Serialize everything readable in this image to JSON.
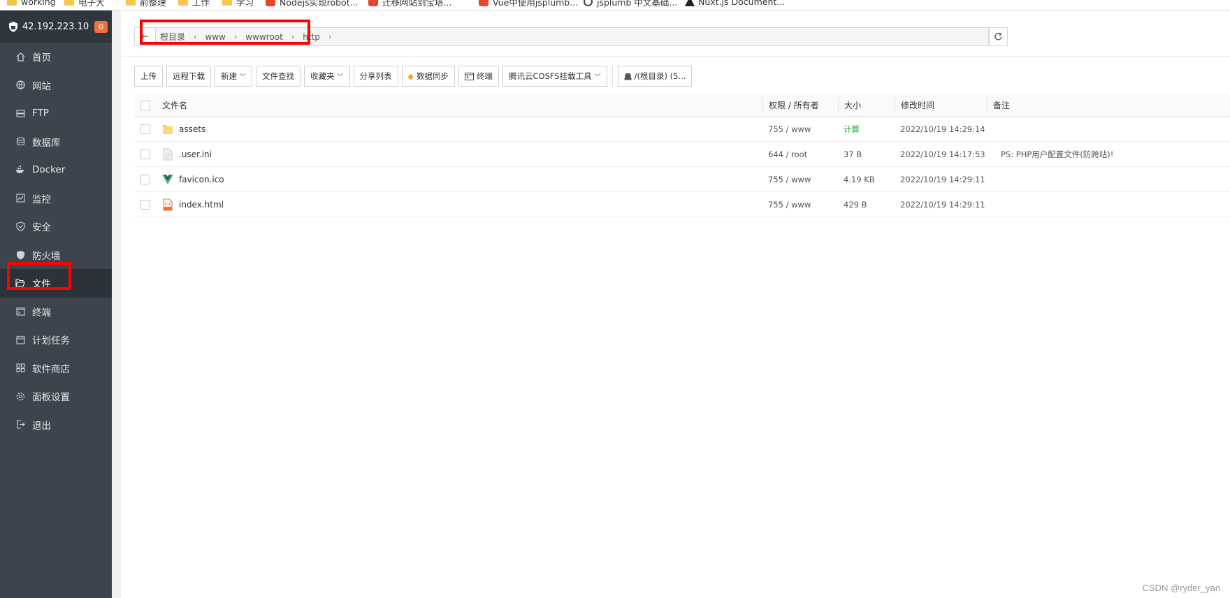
{
  "bookmarks": [
    {
      "label": "working",
      "icon": "folder-icon"
    },
    {
      "label": "电子大",
      "icon": "folder-icon"
    },
    {
      "label": "前整理",
      "icon": "folder-icon"
    },
    {
      "label": "工作",
      "icon": "folder-icon"
    },
    {
      "label": "学习",
      "icon": "folder-icon"
    },
    {
      "label": "Nodejs实现robot...",
      "icon": "csdn-icon"
    },
    {
      "label": "迁移网站到宝塔...",
      "icon": "csdn-icon"
    },
    {
      "label": "Vue中使用jsplumb...",
      "icon": "csdn-icon"
    },
    {
      "label": "jsplumb 中文基础...",
      "icon": "github-icon"
    },
    {
      "label": "Nuxt.js Document...",
      "icon": "nuxt-icon"
    }
  ],
  "sidebar": {
    "host": "42.192.223.10",
    "badge": "0",
    "items": [
      {
        "label": "首页",
        "icon": "home-icon"
      },
      {
        "label": "网站",
        "icon": "globe-icon"
      },
      {
        "label": "FTP",
        "icon": "ftp-icon"
      },
      {
        "label": "数据库",
        "icon": "database-icon"
      },
      {
        "label": "Docker",
        "icon": "docker-icon"
      },
      {
        "label": "监控",
        "icon": "monitor-icon"
      },
      {
        "label": "安全",
        "icon": "shield-check-icon"
      },
      {
        "label": "防火墙",
        "icon": "firewall-icon"
      },
      {
        "label": "文件",
        "icon": "folder-open-icon",
        "active": true
      },
      {
        "label": "终端",
        "icon": "terminal-icon"
      },
      {
        "label": "计划任务",
        "icon": "calendar-icon"
      },
      {
        "label": "软件商店",
        "icon": "grid-icon"
      },
      {
        "label": "面板设置",
        "icon": "gear-icon"
      },
      {
        "label": "退出",
        "icon": "logout-icon"
      }
    ]
  },
  "path": {
    "back": "←",
    "segments": [
      "根目录",
      "www",
      "wwwroot",
      "http"
    ]
  },
  "toolbar": {
    "upload": "上传",
    "remote_download": "远程下载",
    "new": "新建",
    "file_search": "文件查找",
    "favorites": "收藏夹",
    "share_list": "分享列表",
    "data_sync": "数据同步",
    "terminal": "终端",
    "cos_tool": "腾讯云COSFS挂载工具",
    "disk": "/(根目录) (5..."
  },
  "table": {
    "headers": {
      "name": "文件名",
      "perm": "权限 / 所有者",
      "size": "大小",
      "time": "修改时间",
      "note": "备注"
    },
    "rows": [
      {
        "name": "assets",
        "icon": "folder-icon",
        "perm": "755 / www",
        "size": "计算",
        "time": "2022/10/19 14:29:14",
        "note": ""
      },
      {
        "name": ".user.ini",
        "icon": "file-icon",
        "perm": "644 / root",
        "size": "37 B",
        "time": "2022/10/19 14:17:53",
        "note": "PS: PHP用户配置文件(防跨站)!"
      },
      {
        "name": "favicon.ico",
        "icon": "vue-icon",
        "perm": "755 / www",
        "size": "4.19 KB",
        "time": "2022/10/19 14:29:11",
        "note": ""
      },
      {
        "name": "index.html",
        "icon": "html-file-icon",
        "perm": "755 / www",
        "size": "429 B",
        "time": "2022/10/19 14:29:11",
        "note": ""
      }
    ]
  },
  "watermark": "CSDN @ryder_yan",
  "colors": {
    "sidebar_bg": "#3c444d",
    "sidebar_header_bg": "#2f363e",
    "badge": "#f0703c",
    "highlight_box": "#ff0000",
    "calc_green": "#20a53a"
  }
}
